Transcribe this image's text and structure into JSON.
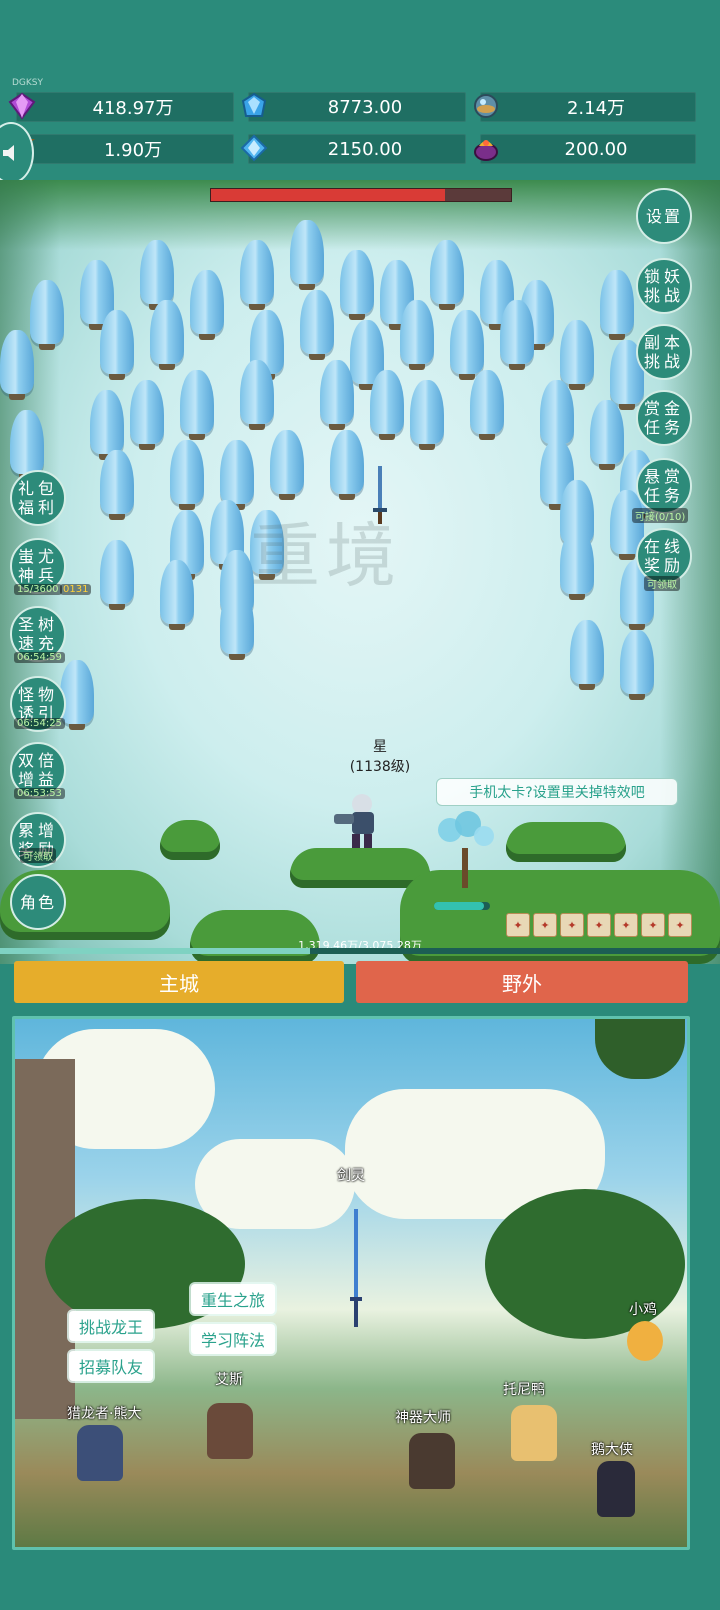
{
  "watermark": "DGKSY",
  "resources": [
    {
      "icon": "purple-gem-icon",
      "value": "418.97万"
    },
    {
      "icon": "blue-crystal-icon",
      "value": "8773.00"
    },
    {
      "icon": "orb-icon",
      "value": "2.14万"
    },
    {
      "icon": "horn-icon",
      "value": "1.90万"
    },
    {
      "icon": "ice-shard-icon",
      "value": "2150.00"
    },
    {
      "icon": "treasure-pot-icon",
      "value": "200.00"
    }
  ],
  "battle": {
    "boss_hp_fraction": 0.78,
    "ink_text": "重境",
    "hero_name": "星",
    "hero_level": "(1138级)",
    "tip": "手机太卡?设置里关掉特效吧",
    "exp_text": "1,319.46万/3,075.28万",
    "exp_fraction": 0.43
  },
  "right_buttons": [
    {
      "label": "设置"
    },
    {
      "label": "锁妖挑战"
    },
    {
      "label": "副本挑战"
    },
    {
      "label": "赏金任务"
    },
    {
      "label": "悬赏任务",
      "note": "可接(0/10)"
    },
    {
      "label": "在线奖励",
      "note": "可领取"
    }
  ],
  "left_buttons": [
    {
      "label": "礼包福利"
    },
    {
      "label": "蚩尤神兵",
      "note": "15/3600",
      "badge": "0131"
    },
    {
      "label": "圣树速充",
      "note": "06:54:59"
    },
    {
      "label": "怪物诱引",
      "note": "06:54:25"
    },
    {
      "label": "双倍增益",
      "note": "06:53:53"
    },
    {
      "label": "累增奖励",
      "note": "可领取"
    },
    {
      "label": "角色"
    }
  ],
  "tabs": {
    "main_city": "主城",
    "wild": "野外"
  },
  "town": {
    "sword_spirit": "剑灵",
    "btn_rebirth": "重生之旅",
    "btn_formation": "学习阵法",
    "btn_dragon": "挑战龙王",
    "btn_recruit": "招募队友",
    "npc_hunter": "猎龙者·熊大",
    "npc_ais": "艾斯",
    "npc_artifact": "神器大师",
    "npc_tony": "托尼鸭",
    "npc_chick": "小鸡",
    "npc_goose": "鹅大侠"
  },
  "colors": {
    "main_city_tab": "#e6ad2b",
    "wild_tab": "#e0654b",
    "panel_teal": "#2b8b7b"
  }
}
